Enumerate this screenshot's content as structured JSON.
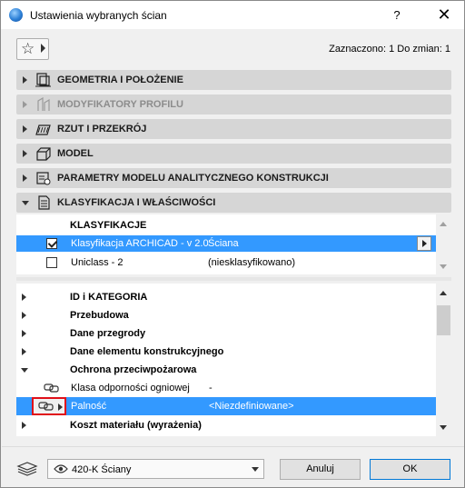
{
  "window": {
    "title": "Ustawienia wybranych ścian",
    "help_label": "?",
    "close_label": "✕"
  },
  "toolbar": {
    "favorites_icon": "star-icon",
    "selected_info": "Zaznaczono: 1 Do zmian: 1"
  },
  "panels": [
    {
      "label": "GEOMETRIA I POŁOŻENIE",
      "icon": "geometry-icon",
      "expanded": false,
      "disabled": false
    },
    {
      "label": "MODYFIKATORY PROFILU",
      "icon": "profile-modifier-icon",
      "expanded": false,
      "disabled": true
    },
    {
      "label": "RZUT I PRZEKRÓJ",
      "icon": "floor-plan-section-icon",
      "expanded": false,
      "disabled": false
    },
    {
      "label": "MODEL",
      "icon": "model-icon",
      "expanded": false,
      "disabled": false
    },
    {
      "label": "PARAMETRY MODELU ANALITYCZNEGO KONSTRUKCJI",
      "icon": "structural-analytical-icon",
      "expanded": false,
      "disabled": false
    },
    {
      "label": "KLASYFIKACJA I WŁAŚCIWOŚCI",
      "icon": "classification-properties-icon",
      "expanded": true,
      "disabled": false
    }
  ],
  "classification": {
    "header": "KLASYFIKACJE",
    "rows": [
      {
        "checked": true,
        "name": "Klasyfikacja ARCHICAD - v 2.0",
        "value": "Ściana",
        "selected": true
      },
      {
        "checked": false,
        "name": "Uniclass - 2",
        "value": "(niesklasyfikowano)",
        "selected": false
      }
    ]
  },
  "properties": {
    "rows": [
      {
        "type": "group",
        "label": "ID i KATEGORIA",
        "expanded": false
      },
      {
        "type": "group",
        "label": "Przebudowa",
        "expanded": false
      },
      {
        "type": "group",
        "label": "Dane przegrody",
        "expanded": false
      },
      {
        "type": "group",
        "label": "Dane elementu konstrukcyjnego",
        "expanded": false
      },
      {
        "type": "group",
        "label": "Ochrona przeciwpożarowa",
        "expanded": true
      },
      {
        "type": "property",
        "label": "Klasa odporności ogniowej",
        "value": "-",
        "linked": true,
        "selected": false
      },
      {
        "type": "property",
        "label": "Palność",
        "value": "<Niezdefiniowane>",
        "linked": true,
        "selected": true
      },
      {
        "type": "group",
        "label": "Koszt materiału (wyrażenia)",
        "expanded": false
      }
    ]
  },
  "footer": {
    "layer_value": "420-K Ściany",
    "cancel_label": "Anuluj",
    "ok_label": "OK"
  },
  "colors": {
    "selection": "#3399ff",
    "panel_header": "#d6d6d6",
    "highlight_box": "#e0101a"
  }
}
